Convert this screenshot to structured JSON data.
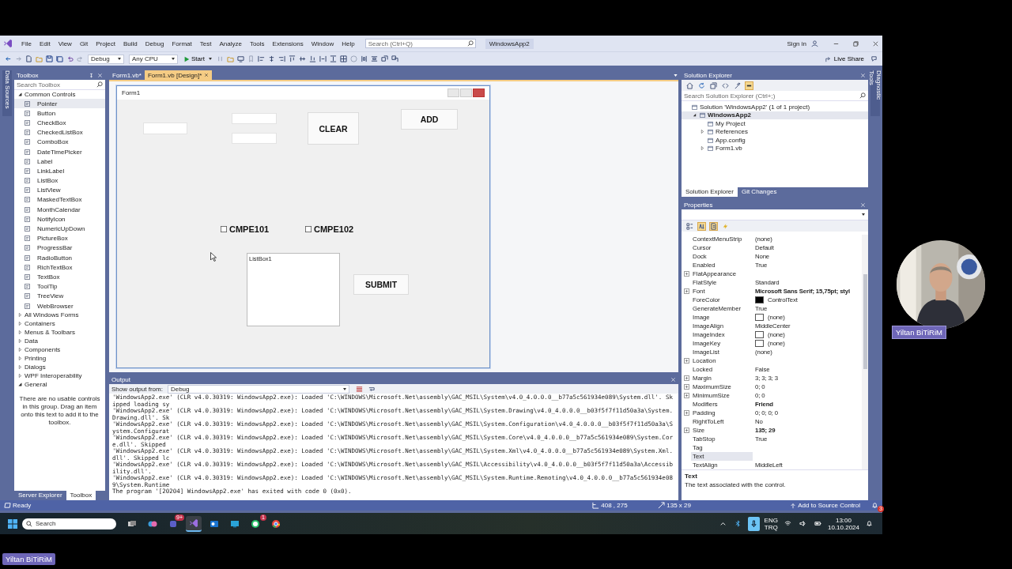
{
  "menu": [
    "File",
    "Edit",
    "View",
    "Git",
    "Project",
    "Build",
    "Debug",
    "Format",
    "Test",
    "Analyze",
    "Tools",
    "Extensions",
    "Window",
    "Help"
  ],
  "search": {
    "placeholder": "Search (Ctrl+Q)"
  },
  "solution_name": "WindowsApp2",
  "sign_in": "Sign in",
  "toolbar": {
    "configuration": "Debug",
    "platform": "Any CPU",
    "start": "Start"
  },
  "live_share": "Live Share",
  "side_tabs": {
    "left": "Data Sources",
    "right": "Diagnostic Tools"
  },
  "toolbox": {
    "title": "Toolbox",
    "search": {
      "placeholder": "Search Toolbox"
    },
    "groups": [
      {
        "label": "Common Controls",
        "expanded": true,
        "items": [
          {
            "label": "Pointer",
            "selected": true
          },
          {
            "label": "Button",
            "selected": false
          },
          {
            "label": "CheckBox",
            "selected": false
          },
          {
            "label": "CheckedListBox",
            "selected": false
          },
          {
            "label": "ComboBox",
            "selected": false
          },
          {
            "label": "DateTimePicker",
            "selected": false
          },
          {
            "label": "Label",
            "selected": false
          },
          {
            "label": "LinkLabel",
            "selected": false
          },
          {
            "label": "ListBox",
            "selected": false
          },
          {
            "label": "ListView",
            "selected": false
          },
          {
            "label": "MaskedTextBox",
            "selected": false
          },
          {
            "label": "MonthCalendar",
            "selected": false
          },
          {
            "label": "NotifyIcon",
            "selected": false
          },
          {
            "label": "NumericUpDown",
            "selected": false
          },
          {
            "label": "PictureBox",
            "selected": false
          },
          {
            "label": "ProgressBar",
            "selected": false
          },
          {
            "label": "RadioButton",
            "selected": false
          },
          {
            "label": "RichTextBox",
            "selected": false
          },
          {
            "label": "TextBox",
            "selected": false
          },
          {
            "label": "ToolTip",
            "selected": false
          },
          {
            "label": "TreeView",
            "selected": false
          },
          {
            "label": "WebBrowser",
            "selected": false
          }
        ]
      },
      {
        "label": "All Windows Forms",
        "expanded": false
      },
      {
        "label": "Containers",
        "expanded": false
      },
      {
        "label": "Menus & Toolbars",
        "expanded": false
      },
      {
        "label": "Data",
        "expanded": false
      },
      {
        "label": "Components",
        "expanded": false
      },
      {
        "label": "Printing",
        "expanded": false
      },
      {
        "label": "Dialogs",
        "expanded": false
      },
      {
        "label": "WPF Interoperability",
        "expanded": false
      },
      {
        "label": "General",
        "expanded": true,
        "empty_text": "There are no usable controls in this group. Drag an item onto this text to add it to the toolbox."
      }
    ],
    "tabs": [
      {
        "label": "Server Explorer",
        "selected": false
      },
      {
        "label": "Toolbox",
        "selected": true
      }
    ]
  },
  "document_tabs": [
    {
      "label": "Form1.vb*",
      "selected": false
    },
    {
      "label": "Form1.vb [Design]*",
      "selected": true
    }
  ],
  "form": {
    "title": "Form1",
    "controls": [
      {
        "kind": "textbox"
      },
      {
        "kind": "textbox"
      },
      {
        "kind": "textbox"
      },
      {
        "kind": "button",
        "text": "CLEAR"
      },
      {
        "kind": "button",
        "text": "ADD"
      },
      {
        "kind": "checkbox",
        "text": "CMPE101",
        "checked": false
      },
      {
        "kind": "checkbox",
        "text": "CMPE102",
        "checked": false
      },
      {
        "kind": "listbox",
        "text": "ListBox1"
      },
      {
        "kind": "button",
        "text": "SUBMIT"
      }
    ]
  },
  "output": {
    "title": "Output",
    "source_label": "Show output from:",
    "source": "Debug",
    "lines": [
      "'WindowsApp2.exe' (CLR v4.0.30319: WindowsApp2.exe): Loaded 'C:\\WINDOWS\\Microsoft.Net\\assembly\\GAC_MSIL\\System\\v4.0_4.0.0.0__b77a5c561934e089\\System.dll'. Skipped loading sy",
      "'WindowsApp2.exe' (CLR v4.0.30319: WindowsApp2.exe): Loaded 'C:\\WINDOWS\\Microsoft.Net\\assembly\\GAC_MSIL\\System.Drawing\\v4.0_4.0.0.0__b03f5f7f11d50a3a\\System.Drawing.dll'. Sk",
      "'WindowsApp2.exe' (CLR v4.0.30319: WindowsApp2.exe): Loaded 'C:\\WINDOWS\\Microsoft.Net\\assembly\\GAC_MSIL\\System.Configuration\\v4.0_4.0.0.0__b03f5f7f11d50a3a\\System.Configurat",
      "'WindowsApp2.exe' (CLR v4.0.30319: WindowsApp2.exe): Loaded 'C:\\WINDOWS\\Microsoft.Net\\assembly\\GAC_MSIL\\System.Core\\v4.0_4.0.0.0__b77a5c561934e089\\System.Core.dll'. Skipped",
      "'WindowsApp2.exe' (CLR v4.0.30319: WindowsApp2.exe): Loaded 'C:\\WINDOWS\\Microsoft.Net\\assembly\\GAC_MSIL\\System.Xml\\v4.0_4.0.0.0__b77a5c561934e089\\System.Xml.dll'. Skipped lc",
      "'WindowsApp2.exe' (CLR v4.0.30319: WindowsApp2.exe): Loaded 'C:\\WINDOWS\\Microsoft.Net\\assembly\\GAC_MSIL\\Accessibility\\v4.0_4.0.0.0__b03f5f7f11d50a3a\\Accessibility.dll'.",
      "'WindowsApp2.exe' (CLR v4.0.30319: WindowsApp2.exe): Loaded 'C:\\WINDOWS\\Microsoft.Net\\assembly\\GAC_MSIL\\System.Runtime.Remoting\\v4.0_4.0.0.0__b77a5c561934e089\\System.Runtime",
      "The program '[20204] WindowsApp2.exe' has exited with code 0 (0x0)."
    ]
  },
  "solution_explorer": {
    "title": "Solution Explorer",
    "search": {
      "placeholder": "Search Solution Explorer (Ctrl+;)"
    },
    "tree": [
      {
        "label": "Solution 'WindowsApp2' (1 of 1 project)",
        "selected": false,
        "children": [
          {
            "label": "WindowsApp2",
            "expanded": true,
            "selected": true,
            "children": [
              {
                "label": "My Project",
                "selected": false
              },
              {
                "label": "References",
                "expanded": false,
                "selected": false
              },
              {
                "label": "App.config",
                "selected": false
              },
              {
                "label": "Form1.vb",
                "expanded": false,
                "selected": false
              }
            ]
          }
        ]
      }
    ],
    "tabs": [
      {
        "label": "Solution Explorer",
        "selected": true
      },
      {
        "label": "Git Changes",
        "selected": false
      }
    ]
  },
  "properties": {
    "title": "Properties",
    "rows": [
      {
        "name": "ContextMenuStrip",
        "value": "(none)",
        "kind": "plain",
        "expandable": false,
        "bold": false,
        "selected": false
      },
      {
        "name": "Cursor",
        "value": "Default",
        "kind": "plain",
        "expandable": false,
        "bold": false,
        "selected": false
      },
      {
        "name": "Dock",
        "value": "None",
        "kind": "plain",
        "expandable": false,
        "bold": false,
        "selected": false
      },
      {
        "name": "Enabled",
        "value": "True",
        "kind": "plain",
        "expandable": false,
        "bold": false,
        "selected": false
      },
      {
        "name": "FlatAppearance",
        "kind": "plain",
        "expandable": true,
        "selected": false
      },
      {
        "name": "FlatStyle",
        "value": "Standard",
        "kind": "plain",
        "expandable": false,
        "bold": false,
        "selected": false
      },
      {
        "name": "Font",
        "value": "Microsoft Sans Serif; 15,75pt; styl",
        "kind": "plain",
        "expandable": true,
        "bold": true,
        "selected": false
      },
      {
        "name": "ForeColor",
        "value": "ControlText",
        "kind": "color",
        "color": "#000000",
        "expandable": false,
        "bold": false,
        "selected": false
      },
      {
        "name": "GenerateMember",
        "value": "True",
        "kind": "plain",
        "expandable": false,
        "bold": false,
        "selected": false
      },
      {
        "name": "Image",
        "value": "(none)",
        "expandable": false,
        "bold": false,
        "selected": false
      },
      {
        "name": "ImageAlign",
        "value": "MiddleCenter",
        "kind": "plain",
        "expandable": false,
        "bold": false,
        "selected": false
      },
      {
        "name": "ImageIndex",
        "value": "(none)",
        "expandable": false,
        "bold": false,
        "selected": false
      },
      {
        "name": "ImageKey",
        "value": "(none)",
        "expandable": false,
        "bold": false,
        "selected": false
      },
      {
        "name": "ImageList",
        "value": "(none)",
        "kind": "plain",
        "expandable": false,
        "bold": false,
        "selected": false
      },
      {
        "name": "Location",
        "kind": "plain",
        "expandable": true,
        "selected": false
      },
      {
        "name": "Locked",
        "value": "False",
        "kind": "plain",
        "expandable": false,
        "bold": false,
        "selected": false
      },
      {
        "name": "Margin",
        "value": "3; 3; 3; 3",
        "kind": "plain",
        "expandable": true,
        "bold": false,
        "selected": false
      },
      {
        "name": "MaximumSize",
        "value": "0; 0",
        "kind": "plain",
        "expandable": true,
        "bold": false,
        "selected": false
      },
      {
        "name": "MinimumSize",
        "value": "0; 0",
        "kind": "plain",
        "expandable": true,
        "bold": false,
        "selected": false
      },
      {
        "name": "Modifiers",
        "value": "Friend",
        "kind": "plain",
        "expandable": false,
        "bold": true,
        "selected": false
      },
      {
        "name": "Padding",
        "value": "0; 0; 0; 0",
        "kind": "plain",
        "expandable": true,
        "bold": false,
        "selected": false
      },
      {
        "name": "RightToLeft",
        "value": "No",
        "kind": "plain",
        "expandable": false,
        "bold": false,
        "selected": false
      },
      {
        "name": "Size",
        "value": "135; 29",
        "kind": "plain",
        "expandable": true,
        "bold": true,
        "selected": false
      },
      {
        "name": "TabStop",
        "value": "True",
        "kind": "plain",
        "expandable": false,
        "bold": false,
        "selected": false
      },
      {
        "name": "Tag",
        "kind": "plain",
        "expandable": false,
        "selected": false
      },
      {
        "name": "Text",
        "kind": "plain",
        "expandable": false,
        "selected": true
      },
      {
        "name": "TextAlign",
        "value": "MiddleLeft",
        "kind": "plain",
        "expandable": false,
        "bold": false,
        "selected": false
      }
    ],
    "description": {
      "title": "Text",
      "text": "The text associated with the control."
    }
  },
  "status_bar": {
    "text": "Ready",
    "position": "408 , 275",
    "size": "135 x 29",
    "source_control": "Add to Source Control",
    "notifications": "3"
  },
  "taskbar": {
    "search": {
      "placeholder": "Search"
    },
    "apps": [
      {
        "kind": "taskview",
        "selected": false
      },
      {
        "kind": "copilot",
        "selected": false
      },
      {
        "kind": "teams",
        "badge": "9+",
        "selected": false
      },
      {
        "kind": "vs",
        "selected": true
      },
      {
        "kind": "outlook",
        "selected": false
      },
      {
        "kind": "monitor",
        "selected": false
      },
      {
        "kind": "whatsapp",
        "badge": "1",
        "selected": false
      },
      {
        "kind": "chrome",
        "selected": false
      }
    ],
    "language": [
      "ENG",
      "TRQ"
    ],
    "time": "13:00",
    "date": "10.10.2024"
  },
  "webcam": {
    "name": "Yiltan BiTiRiM"
  },
  "name_tag": "Yiltan BiTiRiM"
}
